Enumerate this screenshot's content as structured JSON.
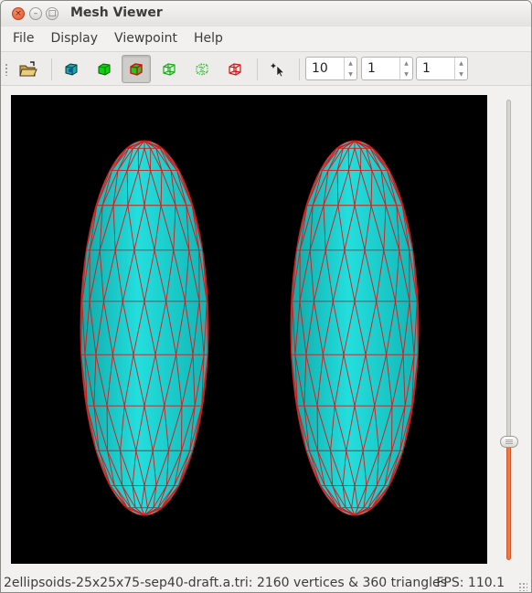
{
  "window": {
    "title": "Mesh Viewer",
    "close_glyph": "×",
    "min_glyph": "–",
    "max_glyph": "□"
  },
  "menu": {
    "items": [
      {
        "label": "File"
      },
      {
        "label": "Display"
      },
      {
        "label": "Viewpoint"
      },
      {
        "label": "Help"
      }
    ]
  },
  "toolbar": {
    "buttons": [
      {
        "icon": "open-folder-icon"
      },
      {
        "icon": "shaded-cube-icon"
      },
      {
        "icon": "solid-cube-icon"
      },
      {
        "icon": "solid-wire-cube-icon",
        "active": true
      },
      {
        "icon": "wireframe-cube-icon"
      },
      {
        "icon": "dotted-wire-cube-icon"
      },
      {
        "icon": "red-wire-cube-icon"
      },
      {
        "icon": "pick-cursor-icon"
      }
    ],
    "spinners": [
      {
        "value": "10"
      },
      {
        "value": "1"
      },
      {
        "value": "1"
      }
    ],
    "spin_up": "▲",
    "spin_down": "▼"
  },
  "viewer": {
    "background": "#000000",
    "mesh_fill": "#1fc9c9",
    "mesh_edge": "#d81818",
    "objects": [
      "left-ellipsoid",
      "right-ellipsoid"
    ]
  },
  "slider": {
    "fill_color": "#f07746",
    "value_fraction": 0.27
  },
  "status": {
    "left": "2ellipsoids-25x25x75-sep40-draft.a.tri: 2160 vertices & 360 triangles",
    "right": "FPS: 110.1"
  }
}
